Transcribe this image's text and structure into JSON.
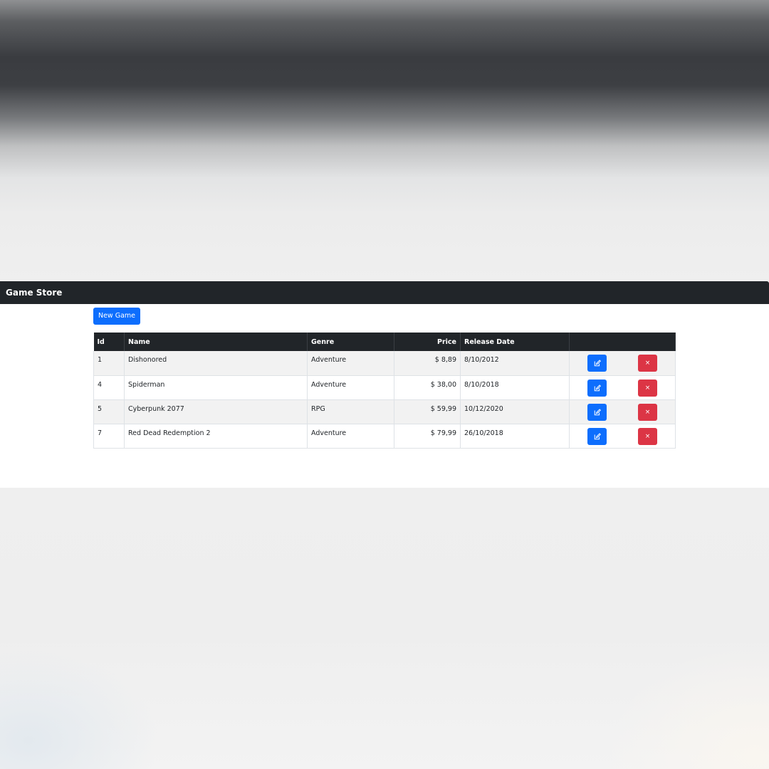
{
  "navbar": {
    "brand": "Game Store"
  },
  "toolbar": {
    "new_game_label": "New Game"
  },
  "table": {
    "headers": {
      "id": "Id",
      "name": "Name",
      "genre": "Genre",
      "price": "Price",
      "release_date": "Release Date",
      "actions": ""
    },
    "rows": [
      {
        "id": "1",
        "name": "Dishonored",
        "genre": "Adventure",
        "price": "$ 8,89",
        "release_date": "8/10/2012"
      },
      {
        "id": "4",
        "name": "Spiderman",
        "genre": "Adventure",
        "price": "$ 38,00",
        "release_date": "8/10/2018"
      },
      {
        "id": "5",
        "name": "Cyberpunk 2077",
        "genre": "RPG",
        "price": "$ 59,99",
        "release_date": "10/12/2020"
      },
      {
        "id": "7",
        "name": "Red Dead Redemption 2",
        "genre": "Adventure",
        "price": "$ 79,99",
        "release_date": "26/10/2018"
      }
    ]
  },
  "icons": {
    "edit": "pencil-square-icon",
    "delete": "close-icon"
  },
  "colors": {
    "navbar_bg": "#212529",
    "primary": "#0d6efd",
    "danger": "#dc3545"
  }
}
